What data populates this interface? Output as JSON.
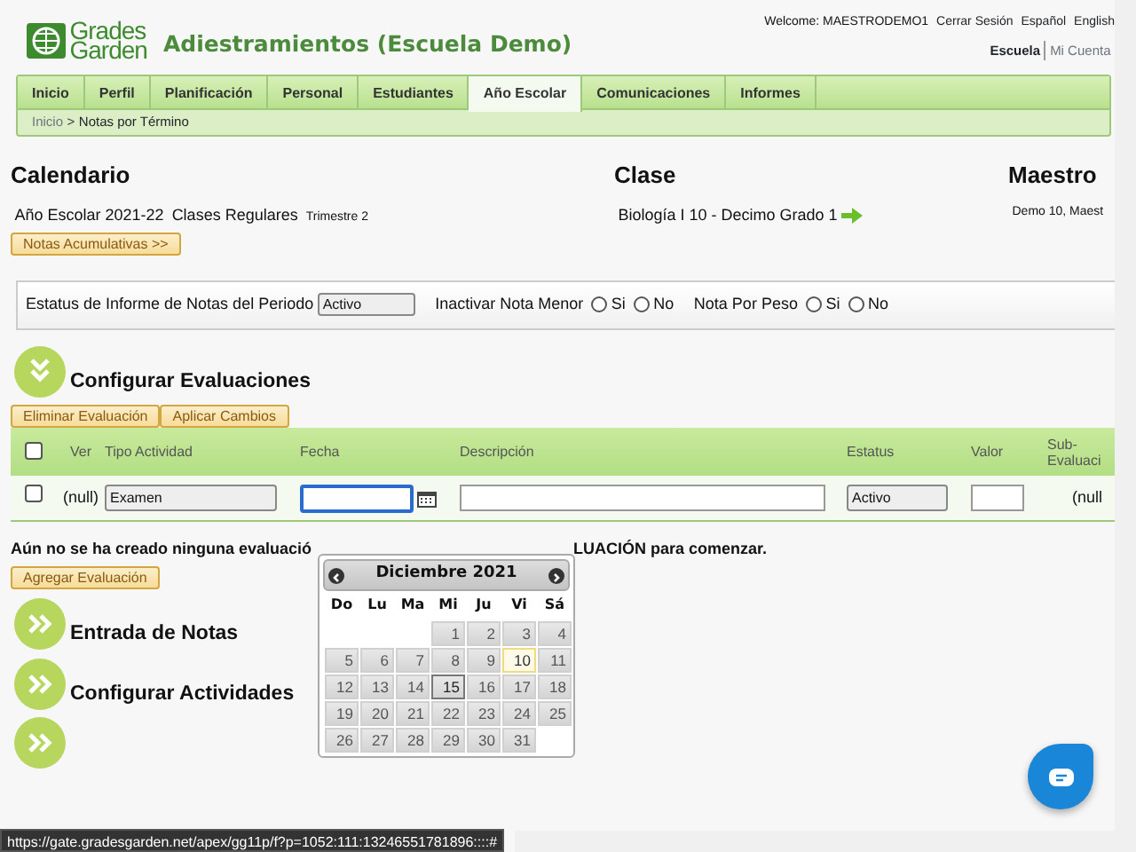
{
  "header": {
    "logo_top": "Grades",
    "logo_bottom": "Garden",
    "title": "Adiestramientos (Escuela Demo)",
    "welcome": "Welcome: MAESTRODEMO1",
    "links": [
      "Cerrar Sesión",
      "Español",
      "English"
    ],
    "account_tabs": [
      {
        "label": "Escuela",
        "selected": true
      },
      {
        "label": "Mi Cuenta",
        "selected": false
      }
    ]
  },
  "nav": [
    {
      "label": "Inicio",
      "selected": false
    },
    {
      "label": "Perfil",
      "selected": false
    },
    {
      "label": "Planificación",
      "selected": false
    },
    {
      "label": "Personal",
      "selected": false
    },
    {
      "label": "Estudiantes",
      "selected": false
    },
    {
      "label": "Año Escolar",
      "selected": true
    },
    {
      "label": "Comunicaciones",
      "selected": false
    },
    {
      "label": "Informes",
      "selected": false
    }
  ],
  "breadcrumb": {
    "separator": ">",
    "items": [
      "Inicio",
      "Notas por Término"
    ]
  },
  "info": {
    "calendar_heading": "Calendario",
    "year": "Año Escolar 2021-22",
    "program": "Clases Regulares",
    "term": "Trimestre 2",
    "accum_button": "Notas Acumulativas >>",
    "class_heading": "Clase",
    "class_name": "Biología I 10 -  Decimo Grado  1",
    "teacher_heading": "Maestro",
    "teacher": "Demo 10, Maest"
  },
  "filters": {
    "status_label": "Estatus de Informe de Notas del Periodo",
    "status_value": "Activo",
    "radio_groups": [
      {
        "label": "Inactivar Nota Menor",
        "options": [
          {
            "label": "Si",
            "checked": false
          },
          {
            "label": "No",
            "checked": false
          }
        ]
      },
      {
        "label": "Nota Por Peso",
        "options": [
          {
            "label": "Si",
            "checked": false
          },
          {
            "label": "No",
            "checked": false
          }
        ]
      }
    ]
  },
  "evaluations": {
    "title": "Configurar Evaluaciones",
    "expanded": true,
    "buttons": [
      "Eliminar Evaluación",
      "Aplicar Cambios"
    ],
    "columns": [
      "Ver",
      "Tipo Actividad",
      "Fecha",
      "Descripción",
      "Estatus",
      "Valor",
      "Sub-\nEvaluaci"
    ],
    "select_all": {
      "checked": false
    },
    "row": {
      "checked": false,
      "ver": "(null)",
      "type": "Examen",
      "status": "Activo",
      "sub": "(null"
    },
    "message_start": "Aún no se ha creado ninguna evaluació",
    "message_end": "LUACIÓN para comenzar.",
    "add_button": "Agregar Evaluación"
  },
  "datepicker": {
    "month": "Diciembre 2021",
    "weekdays": [
      "Do",
      "Lu",
      "Ma",
      "Mi",
      "Ju",
      "Vi",
      "Sá"
    ],
    "weeks": [
      {
        "days": [
          {
            "day": "1",
            "today": false,
            "selected": false
          },
          {
            "day": "2",
            "today": false,
            "selected": false
          },
          {
            "day": "3",
            "today": false,
            "selected": false
          },
          {
            "day": "4",
            "today": false,
            "selected": false
          }
        ]
      },
      {
        "days": [
          {
            "day": "5",
            "today": false,
            "selected": false
          },
          {
            "day": "6",
            "today": false,
            "selected": false
          },
          {
            "day": "7",
            "today": false,
            "selected": false
          },
          {
            "day": "8",
            "today": false,
            "selected": false
          },
          {
            "day": "9",
            "today": false,
            "selected": false
          },
          {
            "day": "10",
            "today": true,
            "selected": false
          },
          {
            "day": "11",
            "today": false,
            "selected": false
          }
        ]
      },
      {
        "days": [
          {
            "day": "12",
            "today": false,
            "selected": false
          },
          {
            "day": "13",
            "today": false,
            "selected": false
          },
          {
            "day": "14",
            "today": false,
            "selected": false
          },
          {
            "day": "15",
            "today": false,
            "selected": true
          },
          {
            "day": "16",
            "today": false,
            "selected": false
          },
          {
            "day": "17",
            "today": false,
            "selected": false
          },
          {
            "day": "18",
            "today": false,
            "selected": false
          }
        ]
      },
      {
        "days": [
          {
            "day": "19",
            "today": false,
            "selected": false
          },
          {
            "day": "20",
            "today": false,
            "selected": false
          },
          {
            "day": "21",
            "today": false,
            "selected": false
          },
          {
            "day": "22",
            "today": false,
            "selected": false
          },
          {
            "day": "23",
            "today": false,
            "selected": false
          },
          {
            "day": "24",
            "today": false,
            "selected": false
          },
          {
            "day": "25",
            "today": false,
            "selected": false
          }
        ]
      },
      {
        "days": [
          {
            "day": "26",
            "today": false,
            "selected": false
          },
          {
            "day": "27",
            "today": false,
            "selected": false
          },
          {
            "day": "28",
            "today": false,
            "selected": false
          },
          {
            "day": "29",
            "today": false,
            "selected": false
          },
          {
            "day": "30",
            "today": false,
            "selected": false
          },
          {
            "day": "31",
            "today": false,
            "selected": false
          }
        ]
      }
    ]
  },
  "sections": [
    {
      "title": "Entrada de Notas",
      "expanded": false
    },
    {
      "title": "Configurar Actividades",
      "expanded": false
    },
    {
      "expanded": false
    }
  ],
  "status_bar": "https://gate.gradesgarden.net/apex/gg11p/f?p=1052:111:13246551781896::::#"
}
